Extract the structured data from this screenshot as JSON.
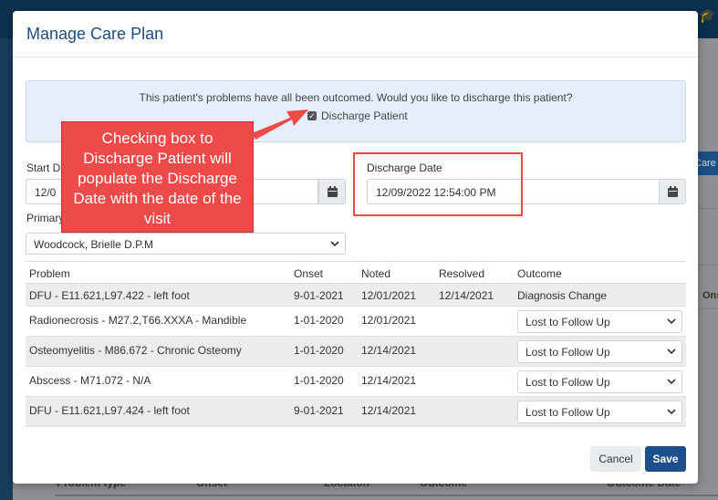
{
  "background": {
    "right_button_label": "Care",
    "right_column_label": "Ons",
    "bottom_headers": [
      "Problem type",
      "Onset",
      "Location",
      "Outcome",
      "Outcome Date"
    ]
  },
  "modal": {
    "title": "Manage Care Plan",
    "alert": {
      "message": "This patient's problems have all been outcomed. Would you like to discharge this patient?",
      "checkbox_label": "Discharge Patient",
      "checked": true
    },
    "start_date": {
      "label": "Start Da",
      "value": "12/0"
    },
    "discharge_date": {
      "label": "Discharge Date",
      "value": "12/09/2022 12:54:00 PM"
    },
    "primary": {
      "label": "Primary",
      "value": "Woodcock, Brielle D.P.M"
    },
    "table": {
      "headers": [
        "Problem",
        "Onset",
        "Noted",
        "Resolved",
        "Outcome"
      ],
      "rows": [
        {
          "problem": "DFU - E11.621,L97.422 - left foot",
          "onset": "9-01-2021",
          "noted": "12/01/2021",
          "resolved": "12/14/2021",
          "outcome": "Diagnosis Change",
          "outcome_is_select": false
        },
        {
          "problem": "Radionecrosis - M27.2,T66.XXXA - Mandible",
          "onset": "1-01-2020",
          "noted": "12/01/2021",
          "resolved": "",
          "outcome": "Lost to Follow Up",
          "outcome_is_select": true
        },
        {
          "problem": "Osteomyelitis - M86.672 - Chronic Osteomy",
          "onset": "1-01-2020",
          "noted": "12/14/2021",
          "resolved": "",
          "outcome": "Lost to Follow Up",
          "outcome_is_select": true
        },
        {
          "problem": "Abscess - M71.072 - N/A",
          "onset": "1-01-2020",
          "noted": "12/14/2021",
          "resolved": "",
          "outcome": "Lost to Follow Up",
          "outcome_is_select": true
        },
        {
          "problem": "DFU - E11.621,L97.424 - left foot",
          "onset": "9-01-2021",
          "noted": "12/14/2021",
          "resolved": "",
          "outcome": "Lost to Follow Up",
          "outcome_is_select": true
        }
      ]
    },
    "buttons": {
      "cancel": "Cancel",
      "save": "Save"
    }
  },
  "annotation": {
    "callout_text": "Checking box to Discharge Patient will populate the Discharge Date with the date of the visit"
  },
  "colors": {
    "accent": "#1c4f8c",
    "annotation": "#ef4a4a",
    "alert_bg": "#e5eefb"
  }
}
